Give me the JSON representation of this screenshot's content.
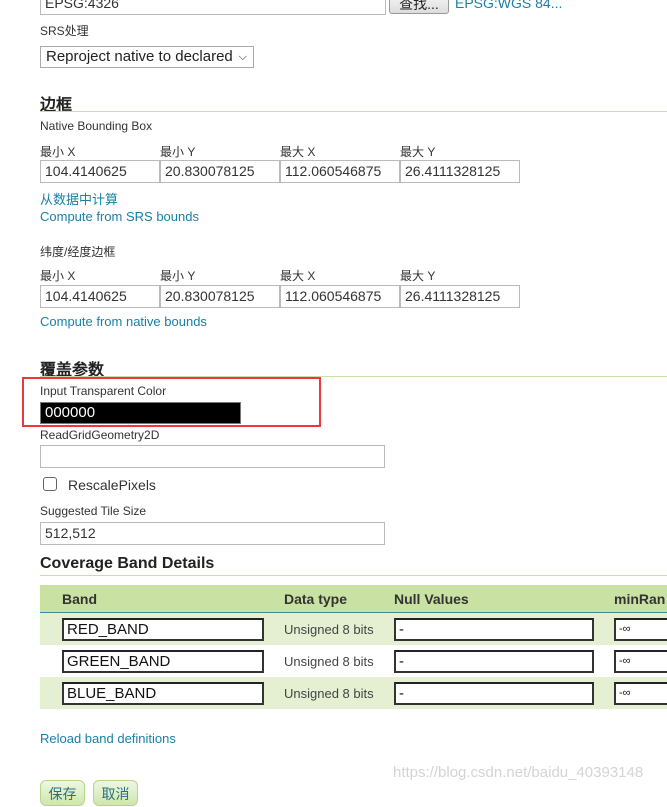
{
  "srs": {
    "declared_value": "EPSG:4326",
    "find_button": "查找...",
    "declared_link": "EPSG:WGS 84...",
    "handling_label": "SRS处理",
    "handling_selected": "Reproject native to declared"
  },
  "bounds": {
    "title": "边框",
    "native": {
      "label": "Native Bounding Box",
      "columns": [
        "最小 X",
        "最小 Y",
        "最大 X",
        "最大 Y"
      ],
      "values": [
        "104.4140625",
        "20.830078125",
        "112.060546875",
        "26.4111328125"
      ],
      "compute_from_data": "从数据中计算",
      "compute_from_srs": "Compute from SRS bounds"
    },
    "latlon": {
      "label": "纬度/经度边框",
      "columns": [
        "最小 X",
        "最小 Y",
        "最大 X",
        "最大 Y"
      ],
      "values": [
        "104.4140625",
        "20.830078125",
        "112.060546875",
        "26.4111328125"
      ],
      "compute_from_native": "Compute from native bounds"
    }
  },
  "coverage_params": {
    "title": "覆盖参数",
    "transparent_color_label": "Input Transparent Color",
    "transparent_color_value": "000000",
    "read_grid_label": "ReadGridGeometry2D",
    "read_grid_value": "",
    "rescale_label": "RescalePixels",
    "rescale_checked": false,
    "tile_size_label": "Suggested Tile Size",
    "tile_size_value": "512,512"
  },
  "band_details": {
    "title": "Coverage Band Details",
    "columns": [
      "Band",
      "Data type",
      "Null Values",
      "minRan"
    ],
    "rows": [
      {
        "band": "RED_BAND",
        "data_type": "Unsigned 8 bits",
        "null_values": "-",
        "min_range": "-∞"
      },
      {
        "band": "GREEN_BAND",
        "data_type": "Unsigned 8 bits",
        "null_values": "-",
        "min_range": "-∞"
      },
      {
        "band": "BLUE_BAND",
        "data_type": "Unsigned 8 bits",
        "null_values": "-",
        "min_range": "-∞"
      }
    ],
    "reload_link": "Reload band definitions"
  },
  "actions": {
    "save": "保存",
    "cancel": "取消"
  },
  "watermark": "https://blog.csdn.net/baidu_40393148",
  "colors": {
    "link": "#1a7fa8",
    "table_header": "#c9e2a3",
    "table_row_alt": "#e4f0d1",
    "highlight": "#e8393f"
  }
}
